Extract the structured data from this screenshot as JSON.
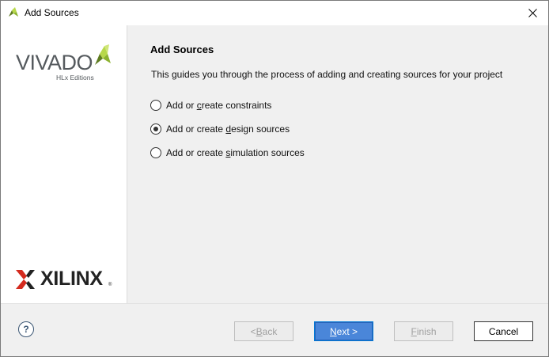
{
  "window": {
    "title": "Add Sources",
    "icon": "vivado-leaf-icon"
  },
  "sidebar": {
    "product_logo": {
      "word": "VIVADO",
      "subtitle": "HLx Editions"
    },
    "vendor_logo": {
      "word": "XILINX",
      "reg": "®"
    }
  },
  "content": {
    "heading": "Add Sources",
    "description": "This guides you through the process of adding and creating sources for your project",
    "options": [
      {
        "pre": "Add or ",
        "key": "c",
        "post": "reate constraints",
        "checked": false
      },
      {
        "pre": "Add or create ",
        "key": "d",
        "post": "esign sources",
        "checked": true
      },
      {
        "pre": "Add or create ",
        "key": "s",
        "post": "imulation sources",
        "checked": false
      }
    ]
  },
  "footer": {
    "help_label": "?",
    "back_pre": "< ",
    "back_key": "B",
    "back_post": "ack",
    "next_key": "N",
    "next_post": "ext >",
    "finish_key": "F",
    "finish_post": "inish",
    "cancel_label": "Cancel"
  },
  "colors": {
    "accent": "#4a86d9",
    "leaf_green": "#9cc33c",
    "xilinx_red": "#d42a1e"
  }
}
